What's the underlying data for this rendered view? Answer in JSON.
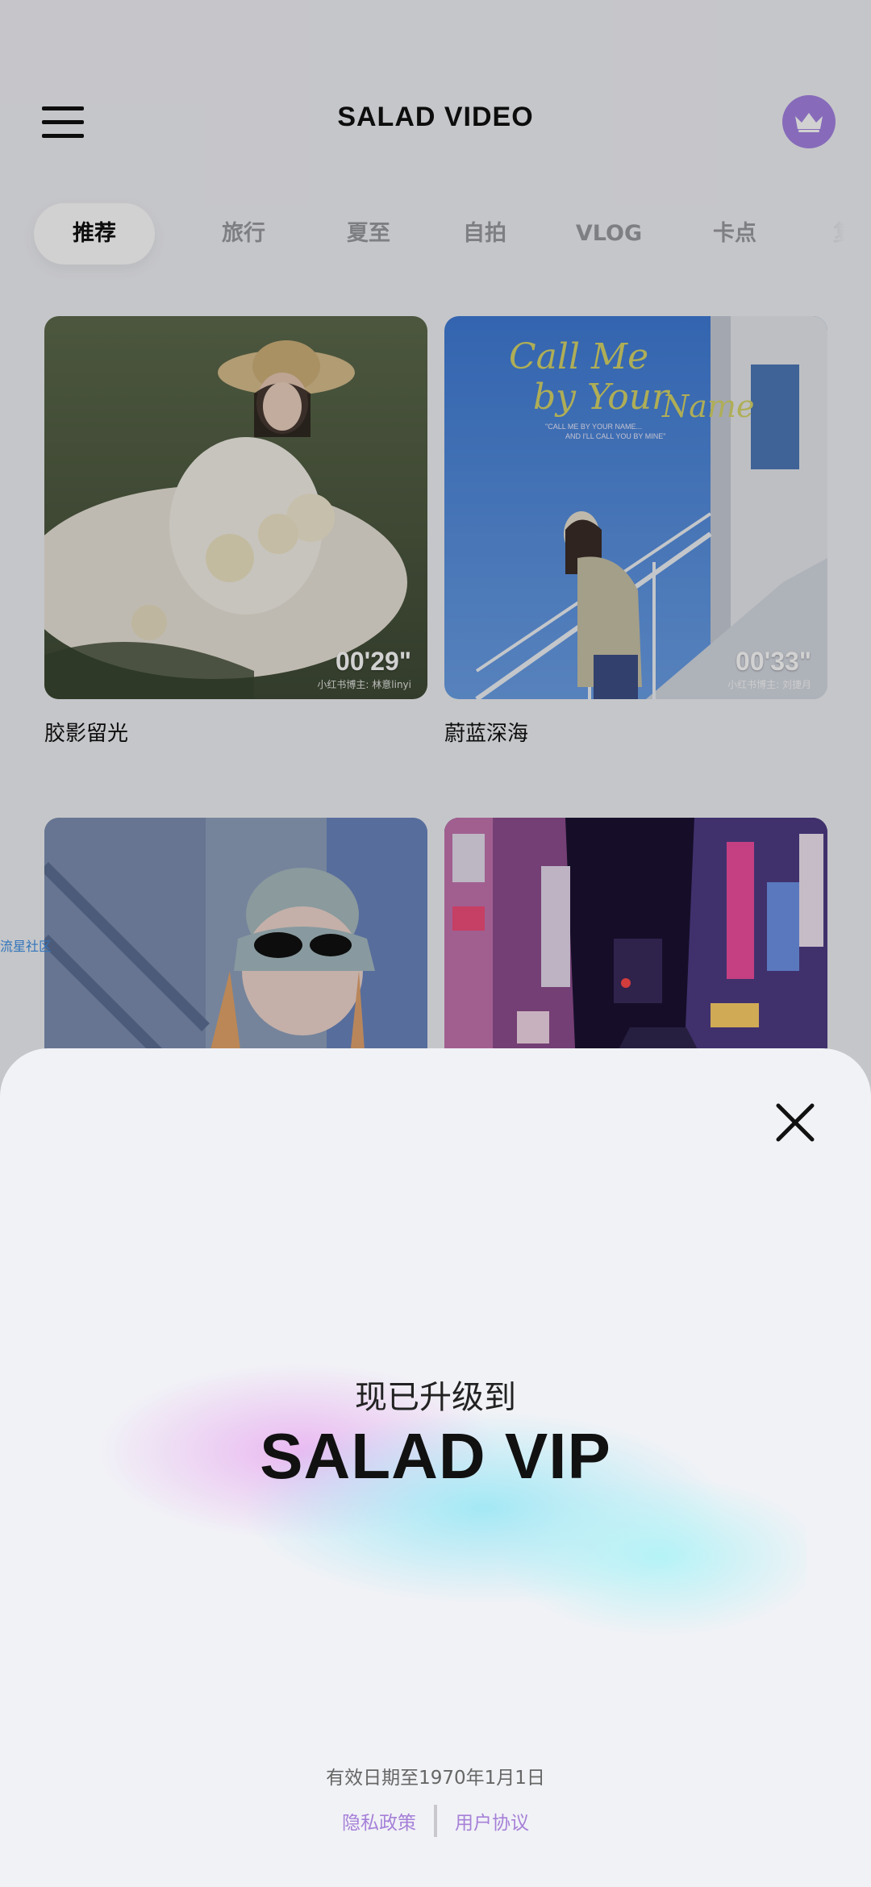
{
  "header": {
    "title": "SALAD VIDEO",
    "menu_icon": "hamburger-menu-icon",
    "vip_icon": "crown-icon",
    "vip_color": "#a583e3"
  },
  "tabs": [
    {
      "label": "推荐",
      "active": true
    },
    {
      "label": "旅行"
    },
    {
      "label": "夏至"
    },
    {
      "label": "自拍"
    },
    {
      "label": "VLOG"
    },
    {
      "label": "卡点"
    },
    {
      "label": "复古"
    }
  ],
  "cards": [
    {
      "title": "胶影留光",
      "duration": "00'29\"",
      "credit": "小红书博主: 林意linyi"
    },
    {
      "title": "蔚蓝深海",
      "duration": "00'33\"",
      "credit": "小红书博主: 刘捷月"
    },
    {
      "title": "",
      "duration": "",
      "credit": ""
    },
    {
      "title": "",
      "duration": "",
      "credit": ""
    }
  ],
  "card2_overlay": {
    "script_line1": "Call Me",
    "script_line2": "by Your",
    "script_line3": "Name",
    "caption_line1": "\"CALL ME BY YOUR NAME...",
    "caption_line2": "AND I'LL CALL YOU BY MINE\""
  },
  "side_text": "流星社区",
  "sheet": {
    "close_icon": "close-icon",
    "upgrade_text": "现已升级到",
    "vip_title": "SALAD VIP",
    "validity": "有效日期至1970年1月1日",
    "privacy_link": "隐私政策",
    "terms_link": "用户协议",
    "link_color": "#a680d8"
  }
}
